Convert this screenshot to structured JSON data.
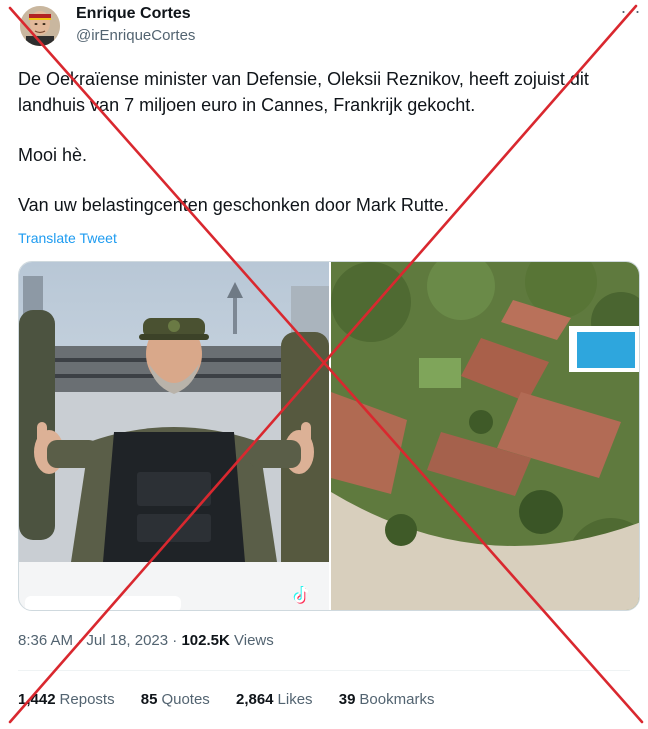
{
  "author": {
    "name": "Enrique Cortes",
    "handle": "@irEnriqueCortes"
  },
  "more_icon": "more-horizontal-icon",
  "tweet": {
    "paragraph_1": "De Oekraïense minister van Defensie, Oleksii Reznikov, heeft zojuist dit landhuis van 7 miljoen euro in Cannes, Frankrijk gekocht.",
    "paragraph_2": "Mooi hè.",
    "paragraph_3": "Van uw belastingcenten geschonken door Mark Rutte."
  },
  "translate_label": "Translate Tweet",
  "media": {
    "left_image": "man-in-military-vest-thumbs-up",
    "right_image": "aerial-view-villa-with-pool",
    "overlay_icon": "tiktok-icon"
  },
  "meta": {
    "time": "8:36 AM",
    "separator": "·",
    "date": "Jul 18, 2023",
    "separator2": "·",
    "views_count": "102.5K",
    "views_label": "Views"
  },
  "stats": {
    "reposts_count": "1,442",
    "reposts_label": "Reposts",
    "quotes_count": "85",
    "quotes_label": "Quotes",
    "likes_count": "2,864",
    "likes_label": "Likes",
    "bookmarks_count": "39",
    "bookmarks_label": "Bookmarks"
  },
  "overlay": {
    "type": "red-x-fact-check-mark",
    "color": "#d9282f"
  },
  "colors": {
    "text": "#0f1419",
    "secondary": "#536471",
    "link": "#1d9bf0"
  }
}
